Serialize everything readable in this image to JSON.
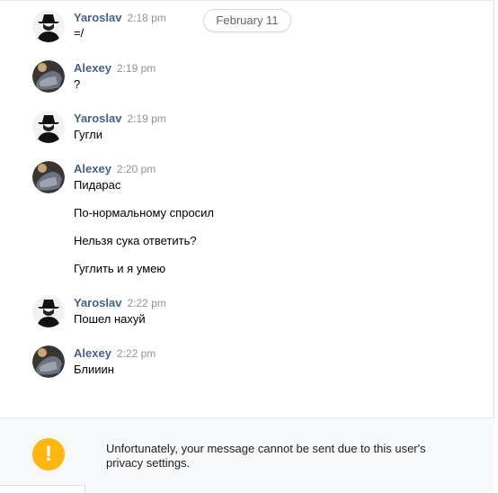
{
  "date_separator": "February 11",
  "messages": [
    {
      "author": "Yaroslav",
      "time": "2:18 pm",
      "avatar": "yaroslav-avatar",
      "lines": [
        "=/"
      ]
    },
    {
      "author": "Alexey",
      "time": "2:19 pm",
      "avatar": "alexey-avatar",
      "lines": [
        "?"
      ]
    },
    {
      "author": "Yaroslav",
      "time": "2:19 pm",
      "avatar": "yaroslav-avatar",
      "lines": [
        "Гугли"
      ]
    },
    {
      "author": "Alexey",
      "time": "2:20 pm",
      "avatar": "alexey-avatar",
      "lines": [
        "Пидарас",
        "По-нормальному спросил",
        "Нельзя сука ответить?",
        "Гуглить и я умею"
      ]
    },
    {
      "author": "Yaroslav",
      "time": "2:22 pm",
      "avatar": "yaroslav-avatar",
      "lines": [
        "Пошел нахуй"
      ]
    },
    {
      "author": "Alexey",
      "time": "2:22 pm",
      "avatar": "alexey-avatar",
      "lines": [
        "Блииин"
      ]
    }
  ],
  "notice": {
    "icon": "warning-icon",
    "symbol": "!",
    "text": "Unfortunately, your message cannot be sent due to this user's privacy settings."
  },
  "colors": {
    "author": "#42648b",
    "time": "#939393",
    "warning": "#ffb70f"
  }
}
